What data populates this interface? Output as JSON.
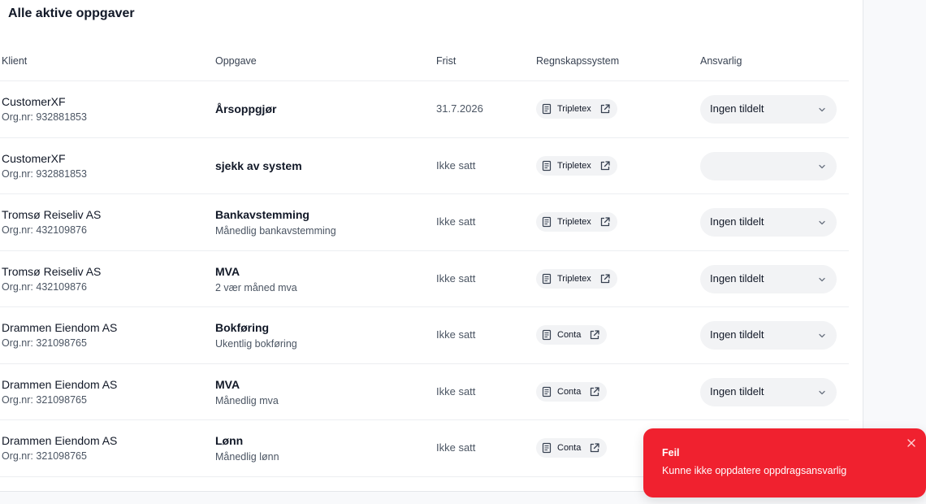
{
  "page": {
    "title": "Alle aktive oppgaver"
  },
  "table": {
    "headers": {
      "client": "Klient",
      "task": "Oppgave",
      "deadline": "Frist",
      "system": "Regnskapssystem",
      "responsible": "Ansvarlig"
    },
    "rows": [
      {
        "client": "CustomerXF",
        "org": "Org.nr: 932881853",
        "task": "Årsoppgjør",
        "task_sub": "",
        "deadline": "31.7.2026",
        "system": "Tripletex",
        "responsible": "Ingen tildelt"
      },
      {
        "client": "CustomerXF",
        "org": "Org.nr: 932881853",
        "task": "sjekk av system",
        "task_sub": "",
        "deadline": "Ikke satt",
        "system": "Tripletex",
        "responsible": ""
      },
      {
        "client": "Tromsø Reiseliv AS",
        "org": "Org.nr: 432109876",
        "task": "Bankavstemming",
        "task_sub": "Månedlig bankavstemming",
        "deadline": "Ikke satt",
        "system": "Tripletex",
        "responsible": "Ingen tildelt"
      },
      {
        "client": "Tromsø Reiseliv AS",
        "org": "Org.nr: 432109876",
        "task": "MVA",
        "task_sub": "2 vær måned mva",
        "deadline": "Ikke satt",
        "system": "Tripletex",
        "responsible": "Ingen tildelt"
      },
      {
        "client": "Drammen Eiendom AS",
        "org": "Org.nr: 321098765",
        "task": "Bokføring",
        "task_sub": "Ukentlig bokføring",
        "deadline": "Ikke satt",
        "system": "Conta",
        "responsible": "Ingen tildelt"
      },
      {
        "client": "Drammen Eiendom AS",
        "org": "Org.nr: 321098765",
        "task": "MVA",
        "task_sub": "Månedlig mva",
        "deadline": "Ikke satt",
        "system": "Conta",
        "responsible": "Ingen tildelt"
      },
      {
        "client": "Drammen Eiendom AS",
        "org": "Org.nr: 321098765",
        "task": "Lønn",
        "task_sub": "Månedlig lønn",
        "deadline": "Ikke satt",
        "system": "Conta",
        "responsible": ""
      }
    ]
  },
  "toast": {
    "title": "Feil",
    "message": "Kunne ikke oppdatere oppdragsansvarlig",
    "color": "#f0212f"
  },
  "icons": {
    "system_badge": "document-icon",
    "external_link": "external-link-icon",
    "dropdown": "chevron-down-icon",
    "close": "close-icon"
  }
}
